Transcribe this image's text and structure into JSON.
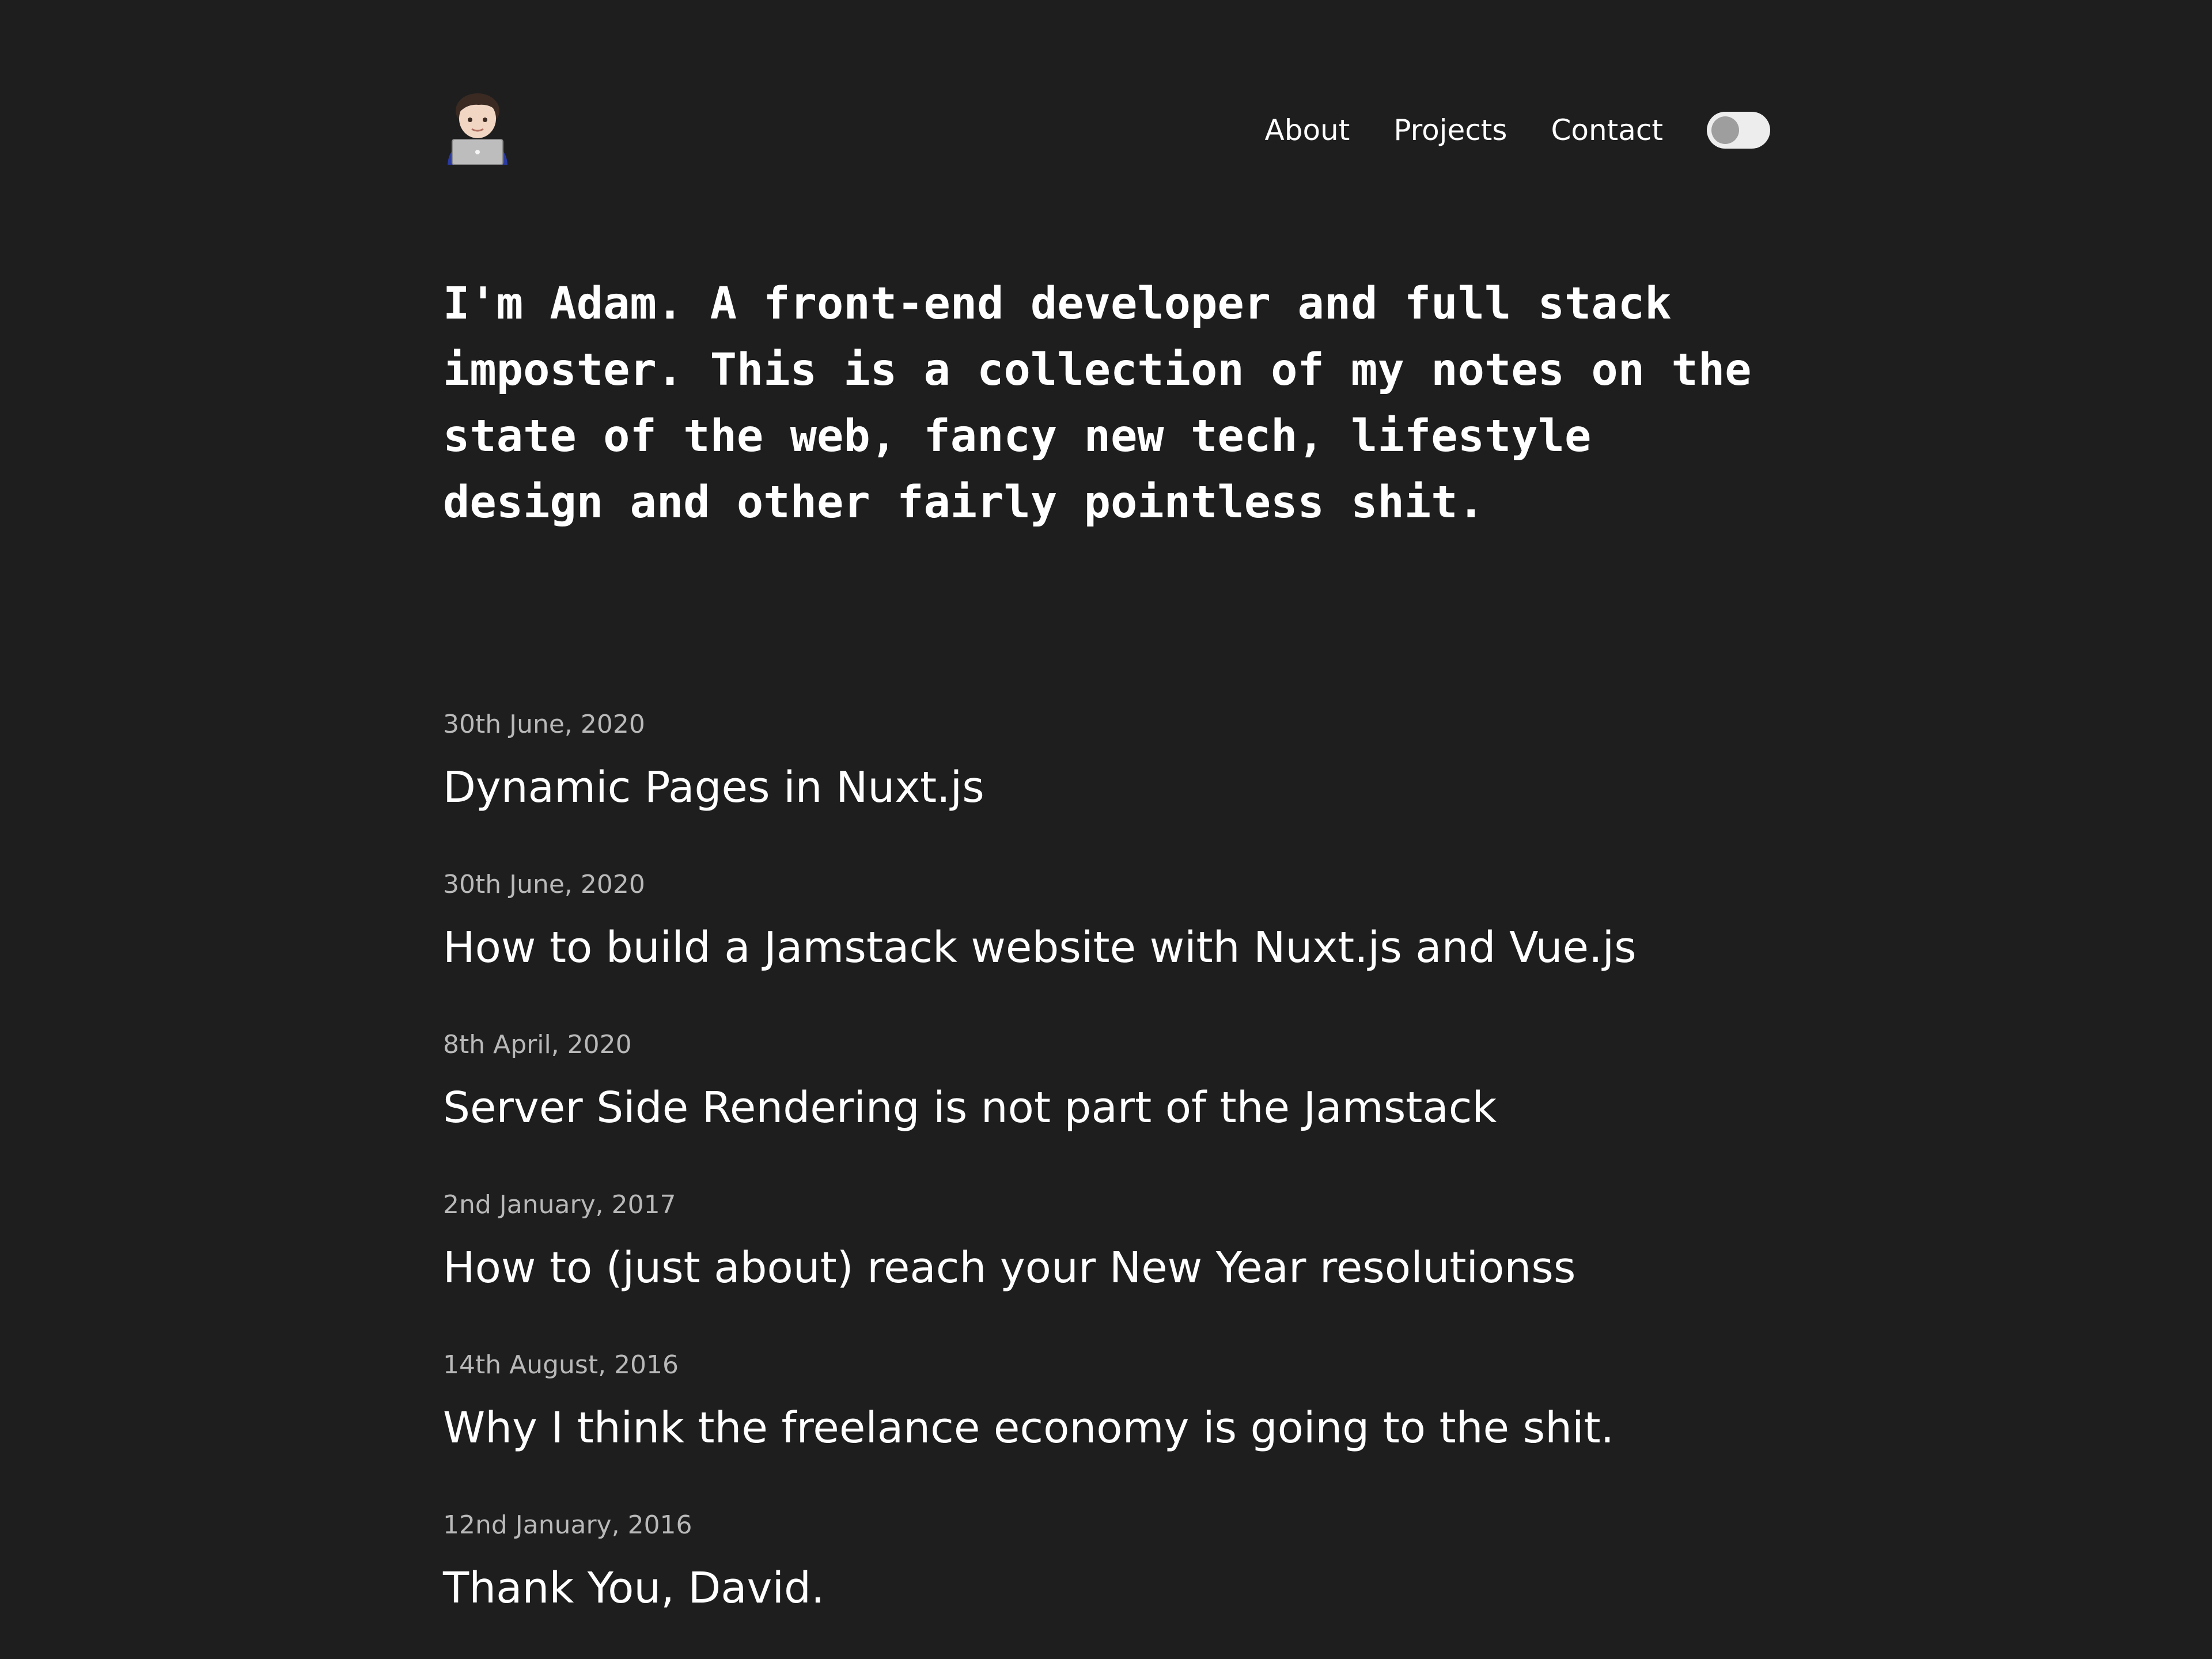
{
  "header": {
    "logo_icon": "technologist-with-laptop-emoji",
    "nav": [
      {
        "label": "About"
      },
      {
        "label": "Projects"
      },
      {
        "label": "Contact"
      }
    ],
    "theme_toggle": {
      "state": "off"
    }
  },
  "intro": {
    "text": "I'm Adam. A front-end developer and full stack imposter. This is a collection of my notes on the state of the web, fancy new tech, lifestyle design and other fairly pointless shit."
  },
  "posts": [
    {
      "date": "30th June, 2020",
      "title": "Dynamic Pages in Nuxt.js"
    },
    {
      "date": "30th June, 2020",
      "title": "How to build a Jamstack website with Nuxt.js and Vue.js"
    },
    {
      "date": "8th April, 2020",
      "title": "Server Side Rendering is not part of the Jamstack"
    },
    {
      "date": "2nd January, 2017",
      "title": "How to (just about) reach your New Year resolutionss"
    },
    {
      "date": "14th August, 2016",
      "title": "Why I think the freelance economy is going to the shit."
    },
    {
      "date": "12nd January, 2016",
      "title": "Thank You, David."
    }
  ]
}
